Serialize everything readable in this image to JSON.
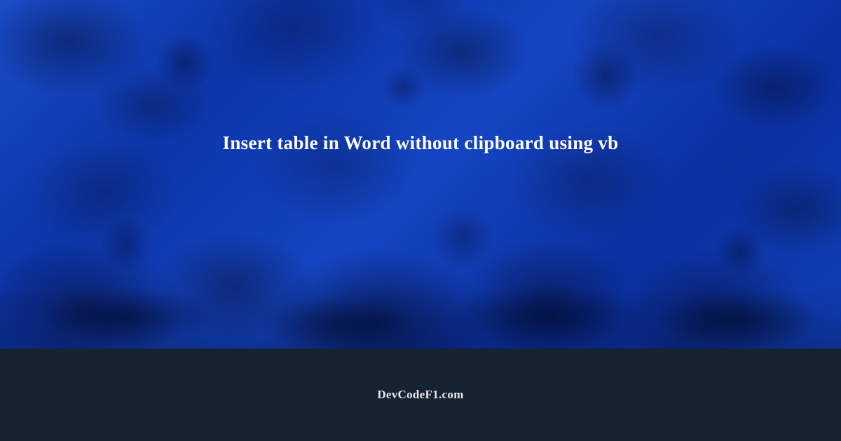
{
  "hero": {
    "title": "Insert table in Word without clipboard using vb"
  },
  "footer": {
    "site_name": "DevCodeF1.com"
  }
}
